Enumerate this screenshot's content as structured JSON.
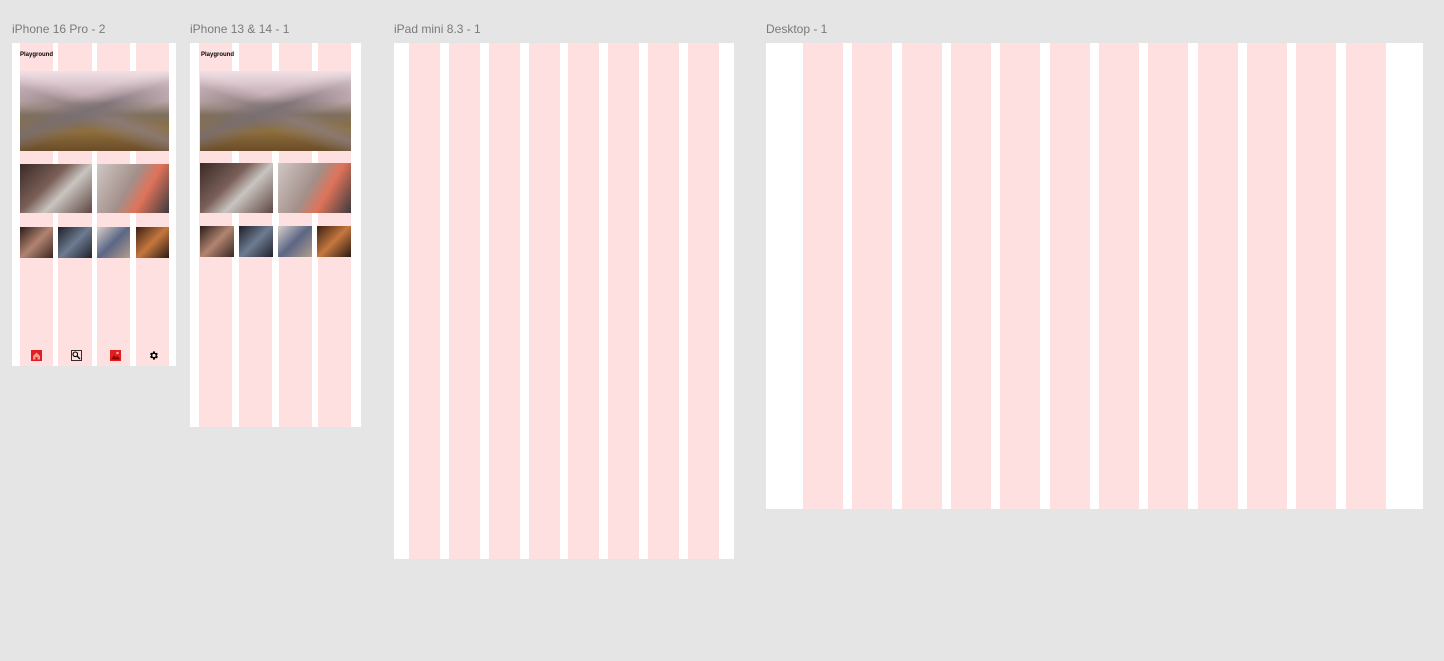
{
  "canvas": {
    "background": "#e5e5e5",
    "column_color": "#ffe0e1"
  },
  "frames": [
    {
      "label": "iPhone 16 Pro - 2",
      "app_title": "Playground"
    },
    {
      "label": "iPhone 13 & 14 - 1",
      "app_title": "Playground"
    },
    {
      "label": "iPad mini 8.3 - 1"
    },
    {
      "label": "Desktop - 1"
    }
  ],
  "bottom_nav": {
    "icons": [
      "home-icon",
      "search-icon",
      "gallery-icon",
      "gear-icon"
    ],
    "accent_color": "#e0201f"
  }
}
